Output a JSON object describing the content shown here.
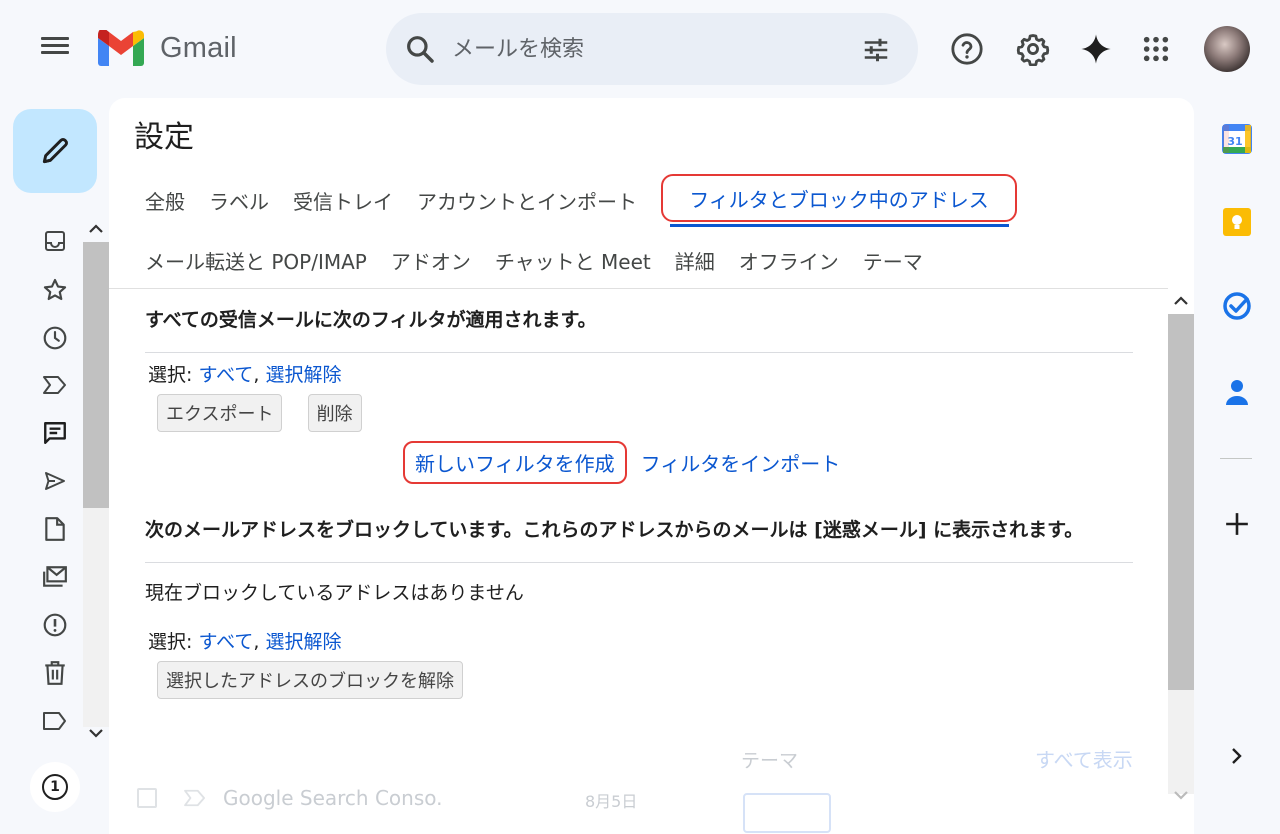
{
  "header": {
    "app_name": "Gmail",
    "search_placeholder": "メールを検索"
  },
  "settings": {
    "title": "設定",
    "tabs_row1": [
      "全般",
      "ラベル",
      "受信トレイ",
      "アカウントとインポート"
    ],
    "active_tab": "フィルタとブロック中のアドレス",
    "tabs_row2": [
      "メール転送と POP/IMAP",
      "アドオン",
      "チャットと Meet",
      "詳細",
      "オフライン",
      "テーマ"
    ]
  },
  "filters": {
    "heading": "すべての受信メールに次のフィルタが適用されます。",
    "select_label": "選択:",
    "select_all": "すべて",
    "select_none": "選択解除",
    "export_button": "エクスポート",
    "delete_button": "削除",
    "create_filter": "新しいフィルタを作成",
    "import_filters": "フィルタをインポート"
  },
  "blocked": {
    "heading": "次のメールアドレスをブロックしています。これらのアドレスからのメールは [迷惑メール] に表示されます。",
    "empty_message": "現在ブロックしているアドレスはありません",
    "select_label": "選択:",
    "select_all": "すべて",
    "select_none": "選択解除",
    "unblock_button": "選択したアドレスのブロックを解除"
  },
  "background": {
    "sender": "Google Search Conso.",
    "date": "8月5日",
    "theme_label": "テーマ",
    "show_all": "すべて表示"
  },
  "rail": {
    "badge_count": "1"
  },
  "colors": {
    "accent": "#0b57d0",
    "highlight_border": "#e53935",
    "compose_bg": "#c2e7ff"
  }
}
